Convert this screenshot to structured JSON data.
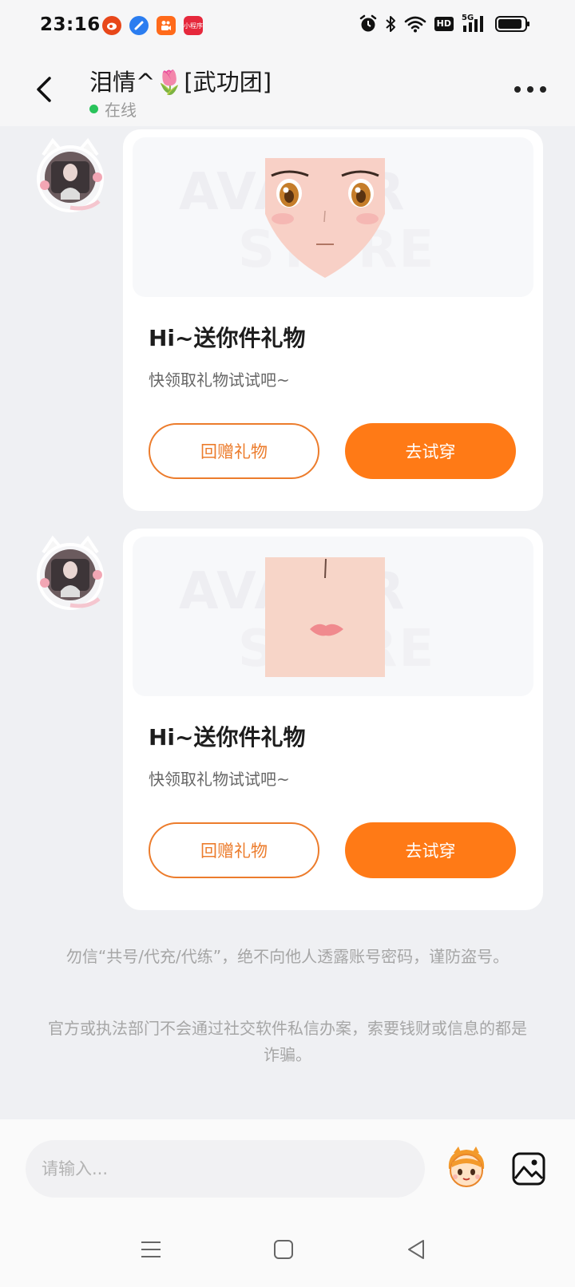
{
  "status_bar": {
    "time": "23:16",
    "app_icons": [
      "weibo-icon",
      "blue-app-icon",
      "kuaishou-icon",
      "mini-app-icon"
    ],
    "mini_app_label": "小程序",
    "hd_label": "HD",
    "network_label": "5G",
    "battery_level": 0.9,
    "system_icons": [
      "alarm-icon",
      "bluetooth-icon",
      "wifi-icon",
      "hd-icon",
      "signal-icon",
      "battery-icon"
    ]
  },
  "header": {
    "title": "泪情^🌷[武功团]",
    "status": "在线"
  },
  "messages": [
    {
      "title": "Hi~送你件礼物",
      "subtitle": "快领取礼物试试吧~",
      "secondary_button": "回赠礼物",
      "primary_button": "去试穿",
      "image_watermark": [
        "AVATAR",
        "STORE"
      ]
    },
    {
      "title": "Hi~送你件礼物",
      "subtitle": "快领取礼物试试吧~",
      "secondary_button": "回赠礼物",
      "primary_button": "去试穿",
      "image_watermark": [
        "AVATAR",
        "STORE"
      ]
    }
  ],
  "notices": [
    "勿信“共号/代充/代练”，绝不向他人透露账号密码，谨防盗号。",
    "官方或执法部门不会通过社交软件私信办案，索要钱财或信息的都是诈骗。"
  ],
  "input": {
    "placeholder": "请输入..."
  },
  "colors": {
    "accent": "#ff7a16",
    "online": "#29c35b",
    "background": "#eff0f3"
  }
}
